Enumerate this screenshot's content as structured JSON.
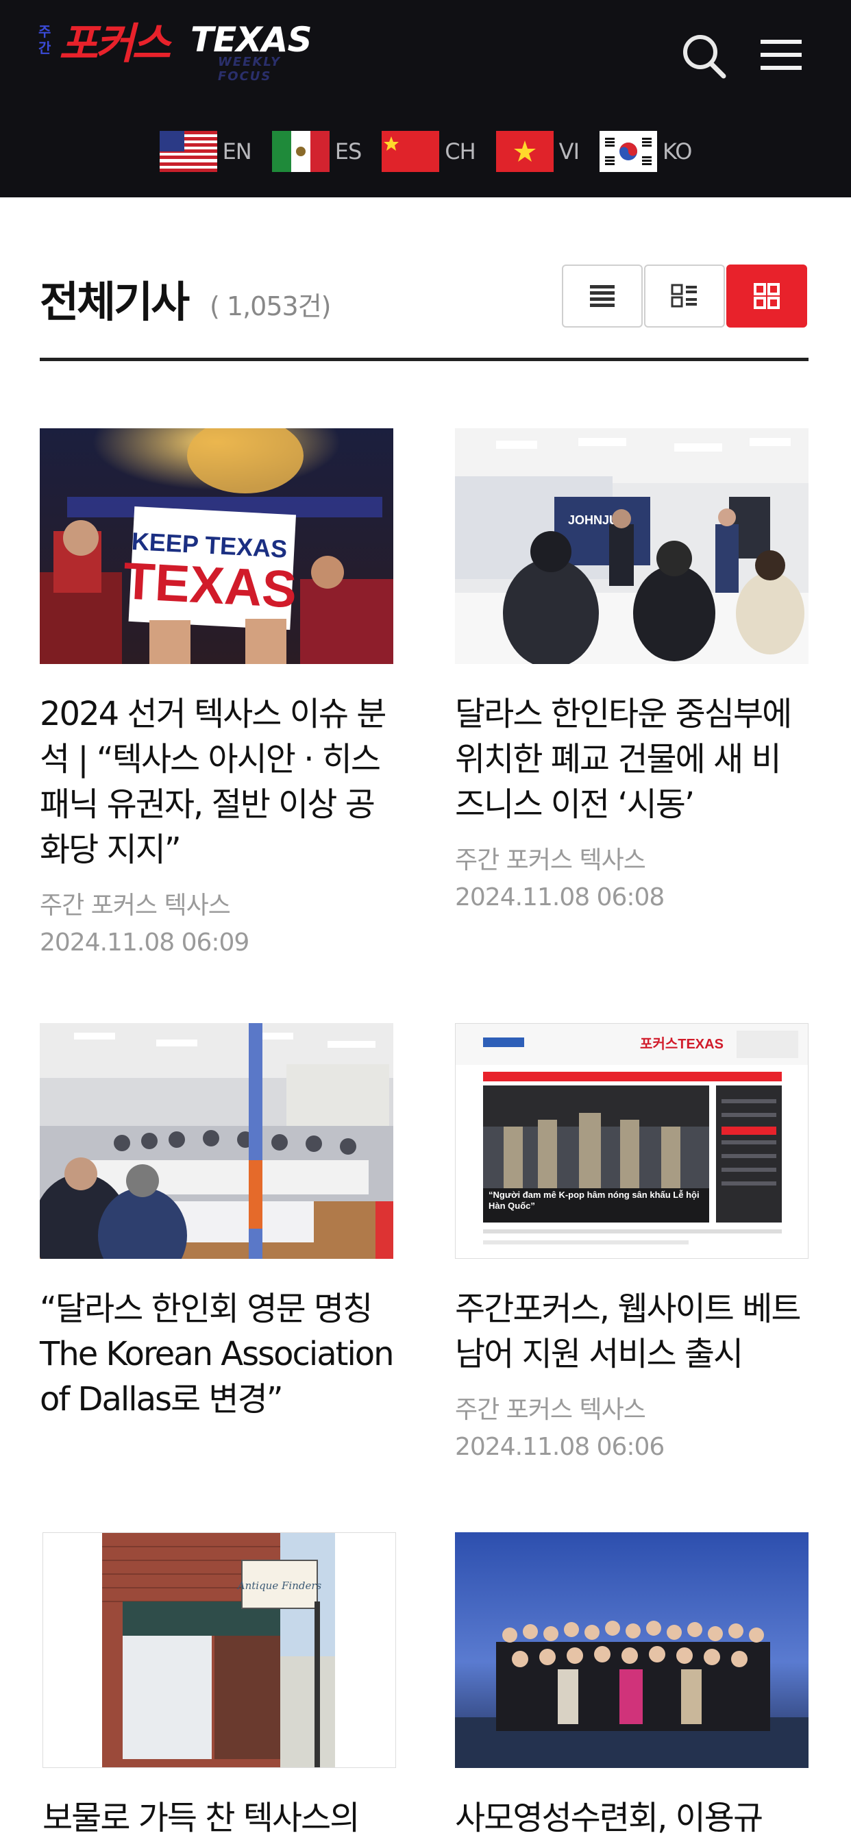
{
  "header": {
    "logo": {
      "vertical_text": "주간",
      "korean_text": "포커스",
      "english_text": "TEXAS",
      "subtitle": "WEEKLY FOCUS"
    },
    "search_icon": "search-icon",
    "menu_icon": "hamburger-menu-icon",
    "languages": [
      {
        "code": "EN",
        "flag": "us-flag-icon"
      },
      {
        "code": "ES",
        "flag": "mexico-flag-icon"
      },
      {
        "code": "CH",
        "flag": "china-flag-icon"
      },
      {
        "code": "VI",
        "flag": "vietnam-flag-icon"
      },
      {
        "code": "KO",
        "flag": "korea-flag-icon"
      }
    ]
  },
  "section": {
    "title": "전체기사",
    "count": "( 1,053건)",
    "view_modes": [
      "list-view-icon",
      "summary-view-icon",
      "grid-view-icon"
    ],
    "active_view": "grid-view-icon"
  },
  "articles": [
    {
      "title": "2024 선거 텍사스 이슈 분석 | “텍사스 아시안 · 히스패닉 유권자, 절반 이상 공화당 지지”",
      "author": "주간 포커스 텍사스",
      "date": "2024.11.08 06:09",
      "image_sign_line1": "KEEP TEXAS",
      "image_sign_line2": "TEXAS"
    },
    {
      "title": "달라스 한인타운 중심부에 위치한 폐교 건물에 새 비즈니스 이전 ‘시동’",
      "author": "주간 포커스 텍사스",
      "date": "2024.11.08 06:08",
      "image_sign_line1": "JOHNJUN",
      "image_sign_line2": ""
    },
    {
      "title": "“달라스 한인회 영문 명칭 The Korean Association of Dallas로 변경”",
      "author": "",
      "date": "",
      "image_sign_line1": "",
      "image_sign_line2": ""
    },
    {
      "title": "주간포커스, 웹사이트 베트남어 지원 서비스 출시",
      "author": "주간 포커스 텍사스",
      "date": "2024.11.08 06:06",
      "image_sign_line1": "“Người đam mê K-pop hâm nóng sân khấu Lễ hội Hàn Quốc”",
      "image_sign_line2": "포커스TEXAS"
    },
    {
      "title": "보물로 가득 찬 텍사스의",
      "author": "",
      "date": "",
      "image_sign_line1": "Antique Finders",
      "image_sign_line2": ""
    },
    {
      "title": "사모영성수련회, 이용규",
      "author": "",
      "date": "",
      "image_sign_line1": "",
      "image_sign_line2": ""
    }
  ],
  "colors": {
    "header_bg": "#101014",
    "accent": "#e8222b",
    "meta_text": "#9a9a9a"
  }
}
